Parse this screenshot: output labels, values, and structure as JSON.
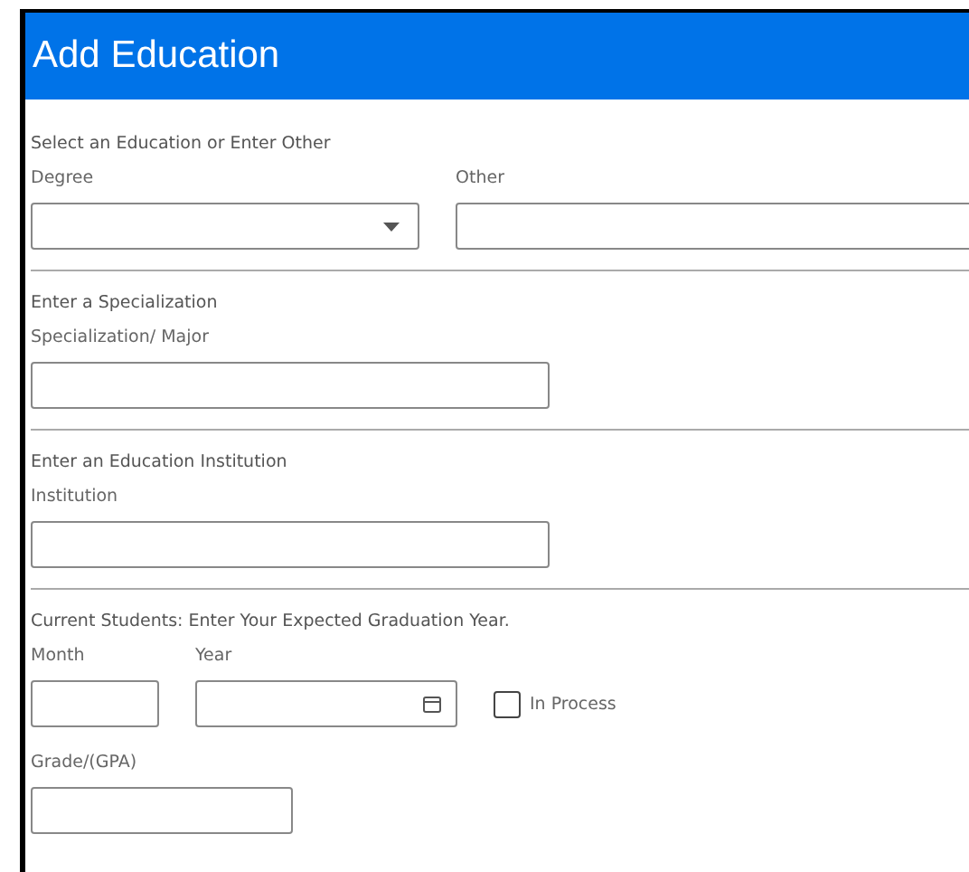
{
  "header": {
    "title": "Add Education"
  },
  "sections": [
    {
      "kind": "degree",
      "heading": "Select an Education or Enter Other",
      "degree_label": "Degree",
      "other_label": "Other"
    },
    {
      "kind": "text",
      "heading": "Enter a Specialization",
      "label": "Specialization/ Major"
    },
    {
      "kind": "text",
      "heading": "Enter an Education Institution",
      "label": "Institution"
    },
    {
      "kind": "graduation",
      "heading": "Current Students: Enter Your Expected Graduation Year.",
      "month_label": "Month",
      "year_label": "Year",
      "in_process": {
        "label": "In Process",
        "checked": false
      },
      "grade_label": "Grade/(GPA)"
    }
  ]
}
